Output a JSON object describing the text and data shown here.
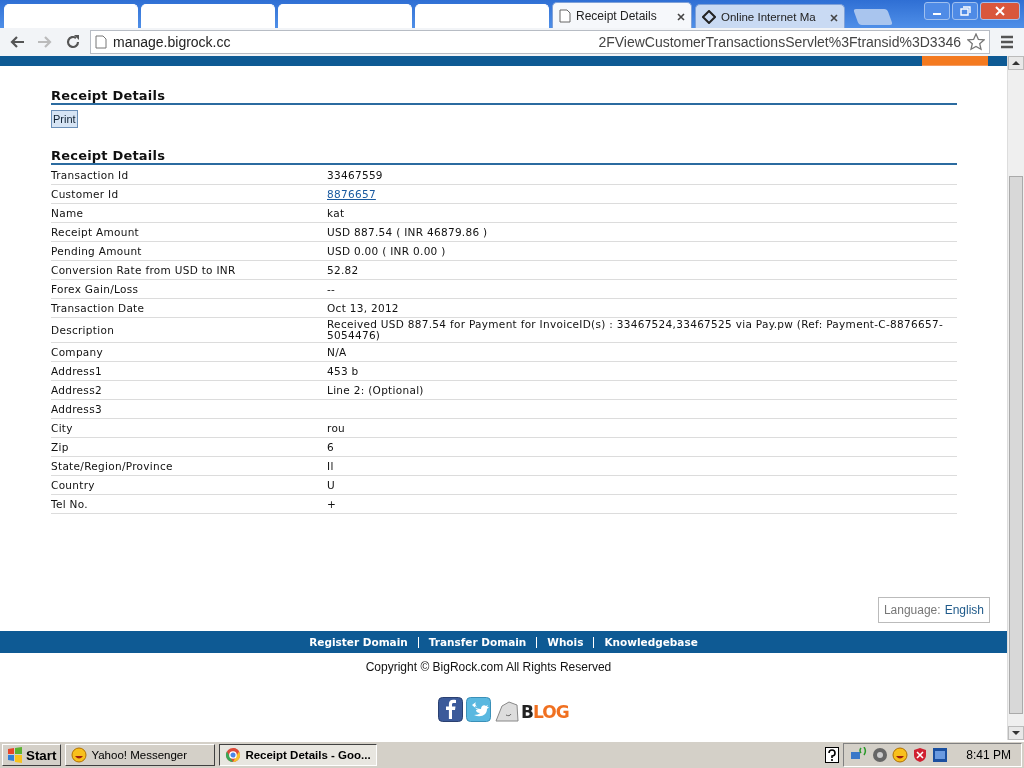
{
  "browser": {
    "tabs": [
      {
        "selected": false
      },
      {
        "selected": false
      },
      {
        "selected": false
      },
      {
        "selected": false
      },
      {
        "label": "Receipt Details",
        "selected": true
      },
      {
        "label": "Online Internet Ma",
        "selected": false
      }
    ],
    "address": {
      "host": "manage.bigrock.cc",
      "tail": "2FViewCustomerTransactionsServlet%3Ftransid%3D3346"
    }
  },
  "page": {
    "print_section": {
      "title": "Receipt Details",
      "button": "Print"
    },
    "details": {
      "title": "Receipt Details",
      "rows": [
        {
          "label": "Transaction Id",
          "value": "33467559",
          "kind": "text"
        },
        {
          "label": "Customer Id",
          "value": "8876657",
          "kind": "link"
        },
        {
          "label": "Name",
          "value": "kat",
          "kind": "text"
        },
        {
          "label": "Receipt Amount",
          "value": "USD 887.54 ( INR 46879.86 )",
          "kind": "text"
        },
        {
          "label": "Pending Amount",
          "value": "USD 0.00 ( INR 0.00 )",
          "kind": "text"
        },
        {
          "label": "Conversion Rate from USD to INR",
          "value": "52.82",
          "kind": "text"
        },
        {
          "label": "Forex Gain/Loss",
          "value": "--",
          "kind": "text"
        },
        {
          "label": "Transaction Date",
          "value": "Oct 13, 2012",
          "kind": "text"
        },
        {
          "label": "Description",
          "value": "Received USD 887.54 for Payment for InvoiceID(s) : 33467524,33467525 via Pay.pw (Ref: Payment-C-8876657-5054476)",
          "kind": "text"
        },
        {
          "label": "Company",
          "value": "N/A",
          "kind": "text"
        },
        {
          "label": "Address1",
          "value": "453 b",
          "kind": "text"
        },
        {
          "label": "Address2",
          "value": "Line 2: (Optional)",
          "kind": "text"
        },
        {
          "label": "Address3",
          "value": "",
          "kind": "text"
        },
        {
          "label": "City",
          "value": "rou",
          "kind": "text"
        },
        {
          "label": "Zip",
          "value": "6",
          "kind": "text"
        },
        {
          "label": "State/Region/Province",
          "value": "Il",
          "kind": "text"
        },
        {
          "label": "Country",
          "value": "U",
          "kind": "text"
        },
        {
          "label": "Tel No.",
          "value": "+",
          "kind": "text"
        }
      ]
    },
    "language": {
      "label": "Language:",
      "value": "English"
    },
    "footer_links": [
      "Register Domain",
      "Transfer Domain",
      "Whois",
      "Knowledgebase"
    ],
    "copyright": "Copyright © BigRock.com All Rights Reserved",
    "blog_logo": "BLOG"
  },
  "taskbar": {
    "start": "Start",
    "tasks": [
      {
        "label": "Yahoo! Messenger",
        "selected": false
      },
      {
        "label": "Receipt Details - Goo...",
        "selected": true
      }
    ],
    "clock": "8:41 PM"
  }
}
